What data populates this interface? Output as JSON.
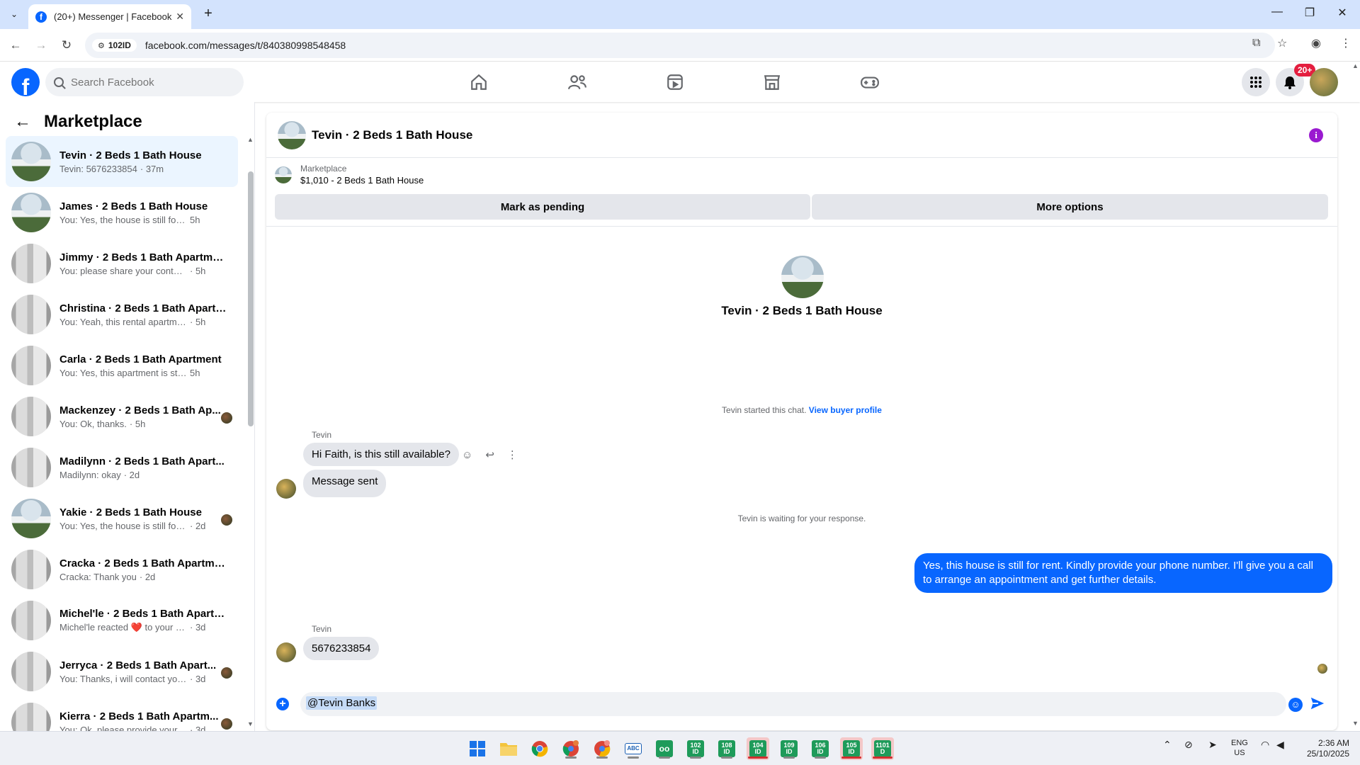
{
  "browser": {
    "tab_title": "(20+) Messenger | Facebook",
    "tab_close": "✕",
    "new_tab": "+",
    "site_chip": "102ID",
    "url": "facebook.com/messages/t/840380998548458"
  },
  "fb": {
    "logo_letter": "f",
    "search_placeholder": "Search Facebook",
    "notification_badge": "20+"
  },
  "sidebar": {
    "title": "Marketplace",
    "conversations": [
      {
        "name": "Tevin · 2 Beds 1 Bath House",
        "preview": "Tevin: 5676233854",
        "time": "· 37m",
        "thumb": "house",
        "active": true,
        "seen": false
      },
      {
        "name": "James · 2 Beds 1 Bath House",
        "preview": "You: Yes, the house is still for rent. ...",
        "time": "5h",
        "thumb": "house",
        "active": false,
        "seen": false
      },
      {
        "name": "Jimmy · 2 Beds 1 Bath Apartment",
        "preview": "You: please share your contact num...",
        "time": "· 5h",
        "thumb": "apt",
        "active": false,
        "seen": false
      },
      {
        "name": "Christina · 2 Beds 1 Bath Apartm...",
        "preview": "You: Yeah, this rental apartment is s...",
        "time": "· 5h",
        "thumb": "apt",
        "active": false,
        "seen": false
      },
      {
        "name": "Carla · 2 Beds 1 Bath Apartment",
        "preview": "You: Yes, this apartment is still avail...",
        "time": "5h",
        "thumb": "apt",
        "active": false,
        "seen": false
      },
      {
        "name": "Mackenzey · 2 Beds 1 Bath Ap...",
        "preview": "You: Ok, thanks.",
        "time": "· 5h",
        "thumb": "apt",
        "active": false,
        "seen": true
      },
      {
        "name": "Madilynn · 2 Beds 1 Bath Apart...",
        "preview": "Madilynn: okay",
        "time": "· 2d",
        "thumb": "apt",
        "active": false,
        "seen": false
      },
      {
        "name": "Yakie · 2 Beds 1 Bath House",
        "preview": "You: Yes, the house is still for ren...",
        "time": "· 2d",
        "thumb": "house",
        "active": false,
        "seen": true
      },
      {
        "name": "Cracka · 2 Beds 1 Bath Apartment",
        "preview": "Cracka: Thank you",
        "time": "· 2d",
        "thumb": "apt",
        "active": false,
        "seen": false
      },
      {
        "name": "Michel'le · 2 Beds 1 Bath Apartm...",
        "preview": "Michel'le reacted ❤️ to your mess...",
        "time": "· 3d",
        "thumb": "apt",
        "active": false,
        "seen": false
      },
      {
        "name": "Jerryca · 2 Beds 1 Bath Apart...",
        "preview": "You: Thanks, i will contact you as...",
        "time": "· 3d",
        "thumb": "apt",
        "active": false,
        "seen": true
      },
      {
        "name": "Kierra · 2 Beds 1 Bath Apartm...",
        "preview": "You: Ok, please provide your co...",
        "time": "· 3d",
        "thumb": "apt",
        "active": false,
        "seen": true
      }
    ]
  },
  "chat": {
    "header_name": "Tevin · 2 Beds 1 Bath House",
    "listing_source": "Marketplace",
    "listing_title": "$1,010 - 2 Beds 1 Bath House",
    "mark_pending": "Mark as pending",
    "more_options": "More options",
    "intro_name": "Tevin · 2 Beds 1 Bath House",
    "started_text": "Tevin started this chat.",
    "view_buyer_profile": "View buyer profile",
    "sender_1": "Tevin",
    "msg_1": "Hi Faith, is this still available?",
    "msg_2": "Message sent",
    "waiting_text": "Tevin is waiting for your response.",
    "my_msg_line1": "Yes, this house is still for rent. Kindly provide your phone number. I'll give you a call",
    "my_msg_line2": "to arrange an appointment and get further details.",
    "sender_2": "Tevin",
    "msg_3": "5676233854",
    "composer_value": "@Tevin Banks"
  },
  "taskbar": {
    "apps": [
      "102 ID",
      "108 ID",
      "104 ID",
      "109 ID",
      "106 ID",
      "105 ID",
      "1101 D"
    ],
    "lang_line1": "ENG",
    "lang_line2": "US",
    "time": "2:36 AM",
    "date": "25/10/2025"
  },
  "colors": {
    "fb_blue": "#0866ff",
    "active_row": "#ebf5ff",
    "badge_red": "#e41e3f"
  }
}
